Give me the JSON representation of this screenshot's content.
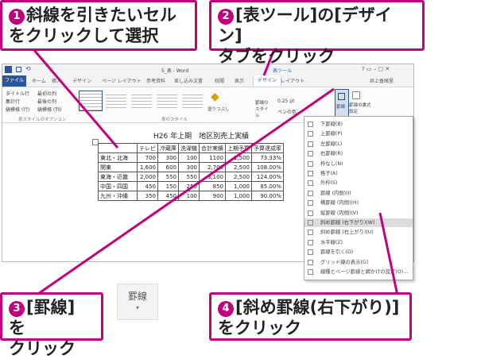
{
  "callouts": {
    "c1": {
      "num": "1",
      "line1": "斜線を引きたいセル",
      "line2": "をクリックして選択"
    },
    "c2": {
      "num": "2",
      "line1": "[表ツール]の[デザイン]",
      "line2": "タブをクリック"
    },
    "c3": {
      "num": "3",
      "line1": "[罫線] を",
      "line2": "クリック"
    },
    "c4": {
      "num": "4",
      "line1": "[斜め罫線(右下がり)]",
      "line2": "をクリック"
    }
  },
  "button_icon": {
    "label": "罫線"
  },
  "word": {
    "window_title": "5_表 - Word",
    "tools_context": "表ツール",
    "window_controls": "?  ▭  –  ▢  ✕",
    "user": "井上香緒里",
    "tabs": [
      "ファイル",
      "ホーム",
      "挿入",
      "デザイン",
      "ページ レイアウト",
      "参考資料",
      "差し込み文書",
      "校閲",
      "表示",
      "デザイン",
      "レイアウト"
    ],
    "options": [
      "タイトル行",
      "集計行",
      "縞模様 (行)",
      "最初の列",
      "最後の列",
      "縞模様 (列)"
    ],
    "group_labels": {
      "options": "表スタイルのオプション",
      "styles": "表のスタイル"
    },
    "shading": "塗りつぶし",
    "border_style": "罫線のスタイル",
    "pen_weight": "0.25 pt",
    "pen_color": "ペンの色",
    "borders_btn": "罫線",
    "painter_btn": "罫線の書式設定",
    "doc_title": "H26 年上期　地区別売上実績",
    "table": {
      "headers": [
        "",
        "テレビ",
        "冷蔵庫",
        "洗濯機",
        "合計実績",
        "上期予算",
        "予算達成率"
      ],
      "rows": [
        [
          "東北・北海",
          "700",
          "300",
          "100",
          "1100",
          "1,500",
          "73.33%"
        ],
        [
          "関東",
          "1,600",
          "600",
          "300",
          "2,700",
          "2,500",
          "108.00%"
        ],
        [
          "東海・近畿",
          "2,000",
          "550",
          "550",
          "3,100",
          "2,500",
          "124.00%"
        ],
        [
          "中国・四国",
          "450",
          "150",
          "250",
          "850",
          "1,000",
          "85.00%"
        ],
        [
          "九州・沖縄",
          "350",
          "450",
          "100",
          "900",
          "1,000",
          "90.00%"
        ]
      ]
    }
  },
  "menu": {
    "items": [
      "下罫線(B)",
      "上罫線(P)",
      "左罫線(L)",
      "右罫線(R)",
      "枠なし(N)",
      "格子(A)",
      "外枠(S)",
      "罫線 (内側)(I)",
      "横罫線 (内側)(H)",
      "縦罫線 (内側)(V)",
      "斜め罫線 (右下がり)(W)",
      "斜め罫線 (右上がり)(U)",
      "水平線(Z)",
      "罫線を引く(D)",
      "グリッド線の表示(G)",
      "線種とページ罫線と網かけの設定(O)..."
    ],
    "highlight_index": 10
  },
  "colors": {
    "accent": "#c3007d",
    "word_blue": "#2b579a"
  }
}
